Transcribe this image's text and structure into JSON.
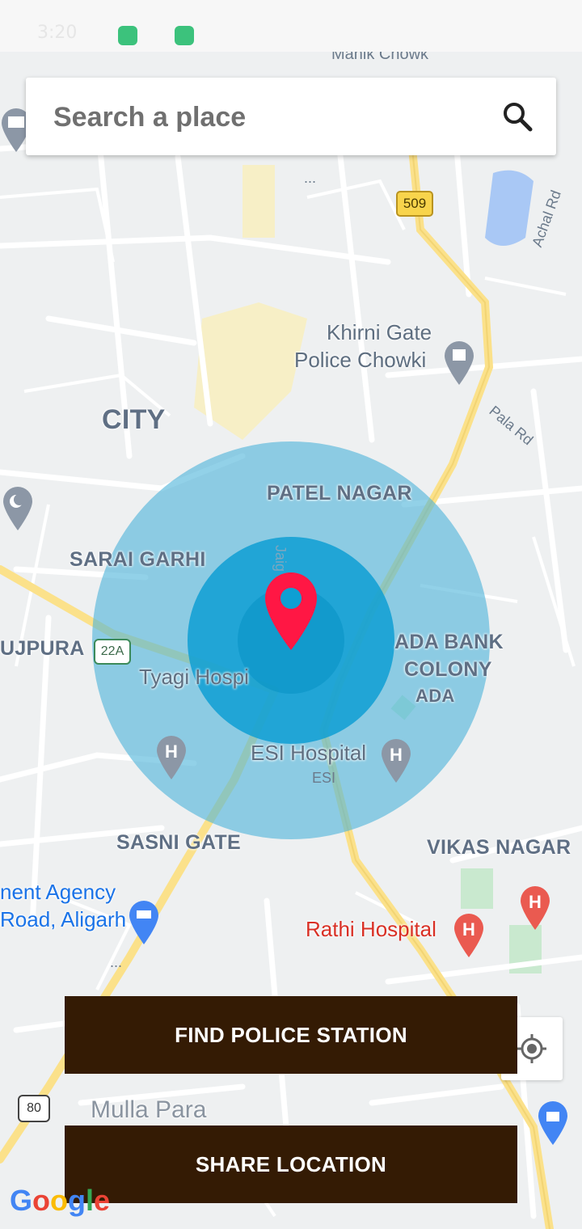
{
  "status_bar": {
    "time": "3:20"
  },
  "search": {
    "placeholder": "Search a place"
  },
  "map": {
    "labels": {
      "manik_chowk": "Manik Chowk",
      "khirni_gate_1": "Khirni Gate",
      "khirni_gate_2": "Police Chowki",
      "city": "CITY",
      "patel_nagar": "PATEL NAGAR",
      "sarai_garhi": "SARAI GARHI",
      "ujpura": "UJPURA",
      "ada_bank_1": "ADA BANK",
      "ada_bank_2": "COLONY",
      "ada": "ADA",
      "tyagi_hospital": "Tyagi Hospi",
      "esi_hospital": "ESI Hospital",
      "esi": "ESI",
      "sasni_gate": "SASNI GATE",
      "vikas_nagar": "VIKAS NAGAR",
      "agency_1": "nent Agency",
      "agency_2": "Road, Aligarh",
      "rathi_hospital": "Rathi Hospital",
      "mulla_para": "Mulla Para",
      "achal_rd": "Achal Rd",
      "pala_rd": "Pala Rd",
      "jaig": "Jaig",
      "ellipsis_1": "...",
      "ellipsis_2": "..."
    },
    "shields": {
      "r509": "509",
      "r22a": "22A",
      "r80": "80"
    },
    "marker_color": "#ff1744",
    "outer_circle_color": "#4fb5da",
    "inner_circle_color": "#0e9fd3"
  },
  "buttons": {
    "find_police_station": "FIND POLICE STATION",
    "share_location": "SHARE LOCATION"
  },
  "branding": {
    "google": [
      "G",
      "o",
      "o",
      "g",
      "l",
      "e"
    ]
  },
  "colors": {
    "button_bg": "#341b04",
    "button_text": "#ffffff"
  }
}
